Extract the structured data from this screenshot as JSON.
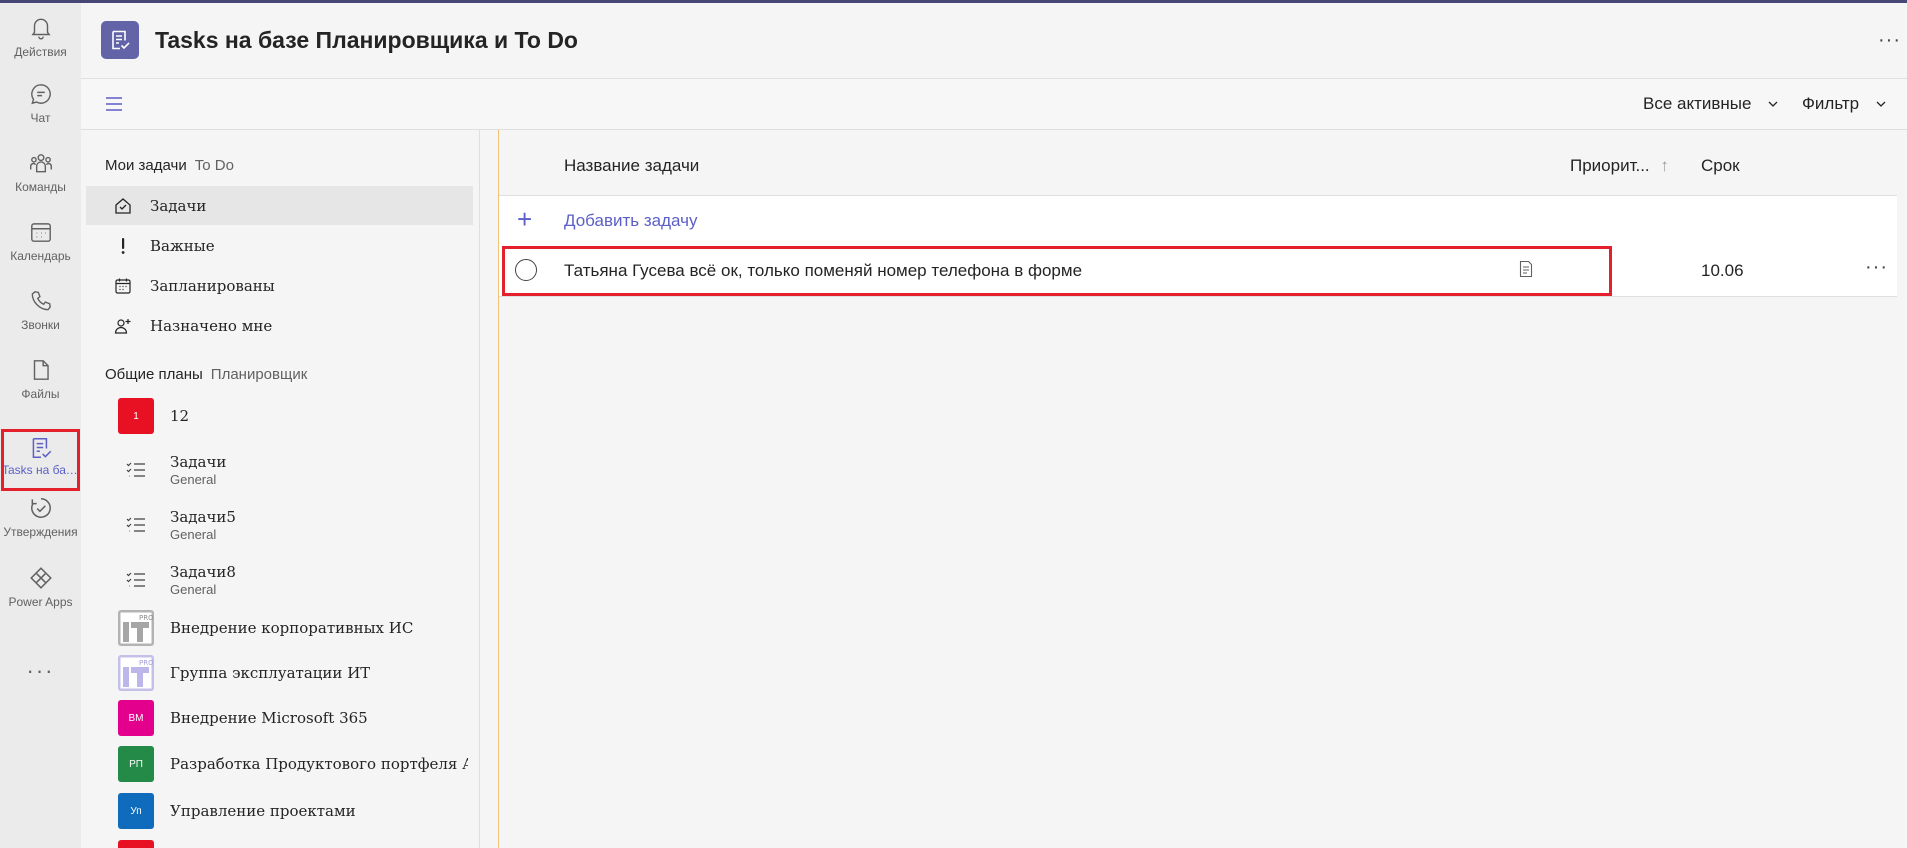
{
  "rail": {
    "items": [
      {
        "label": "Действия",
        "icon": "bell-icon"
      },
      {
        "label": "Чат",
        "icon": "chat-icon"
      },
      {
        "label": "Команды",
        "icon": "teams-icon"
      },
      {
        "label": "Календарь",
        "icon": "calendar-icon"
      },
      {
        "label": "Звонки",
        "icon": "phone-icon"
      },
      {
        "label": "Файлы",
        "icon": "file-icon"
      },
      {
        "label": "Tasks на базе Планировщика и To Do",
        "icon": "tasks-icon"
      },
      {
        "label": "Утверждения",
        "icon": "approvals-icon"
      },
      {
        "label": "Power Apps",
        "icon": "power-apps-icon"
      }
    ],
    "more": "···"
  },
  "header": {
    "title": "Tasks на базе Планировщика и To Do",
    "more": "···"
  },
  "toolbar": {
    "view_filter": "Все активные",
    "filter": "Фильтр"
  },
  "leftnav": {
    "my_tasks": {
      "title": "Мои задачи",
      "subtitle": "To Do"
    },
    "my_items": [
      {
        "label": "Задачи",
        "icon": "home-check-icon"
      },
      {
        "label": "Важные",
        "icon": "exclamation-icon"
      },
      {
        "label": "Запланированы",
        "icon": "calendar-grid-icon"
      },
      {
        "label": "Назначено мне",
        "icon": "person-add-icon"
      }
    ],
    "shared": {
      "title": "Общие планы",
      "subtitle": "Планировщик"
    },
    "plans": [
      {
        "name": "12",
        "badge": "1",
        "color": "#e81123",
        "sub": ""
      },
      {
        "name": "Задачи",
        "badge": "",
        "color": "",
        "sub": "General"
      },
      {
        "name": "Задачи5",
        "badge": "",
        "color": "",
        "sub": "General"
      },
      {
        "name": "Задачи8",
        "badge": "",
        "color": "",
        "sub": "General"
      },
      {
        "name": "Внедрение корпоративных ИС",
        "badge": "",
        "color": "#b3b3b3",
        "sub": ""
      },
      {
        "name": "Группа эксплуатации ИТ",
        "badge": "",
        "color": "#c5c0e8",
        "sub": ""
      },
      {
        "name": "Внедрение Microsoft 365",
        "badge": "ВМ",
        "color": "#e3008c",
        "sub": ""
      },
      {
        "name": "Разработка Продуктового портфеля А...",
        "badge": "РП",
        "color": "#238a47",
        "sub": ""
      },
      {
        "name": "Управление проектами",
        "badge": "Уп",
        "color": "#0f6cbd",
        "sub": ""
      }
    ],
    "logo_badge_text": "PRO"
  },
  "main": {
    "columns": {
      "name": "Название задачи",
      "priority": "Приорит...",
      "priority_sort": "↑",
      "due": "Срок"
    },
    "add_task": "Добавить задачу",
    "tasks": [
      {
        "title": "Татьяна Гусева всё ок, только поменяй номер телефона в форме",
        "due": "10.06",
        "more": "···"
      }
    ]
  },
  "colors": {
    "accent": "#5b5fc7",
    "highlight": "#e3202b",
    "app_logo": "#6264a7"
  }
}
